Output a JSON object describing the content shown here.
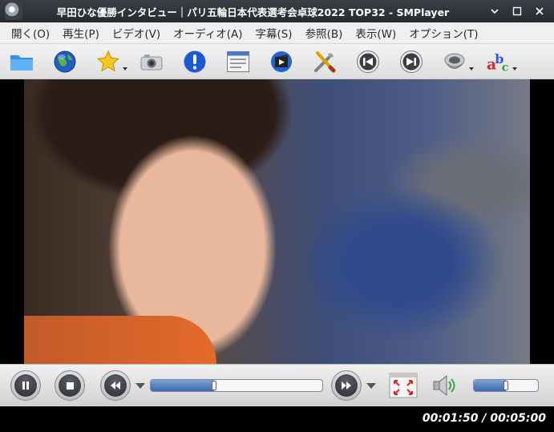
{
  "window": {
    "title": "早田ひな󠄀󠄀優勝インタビュー｜パリ五輪日本代表選考会󠄀󠄀卓球2022 TOP32 - SMPlayer",
    "minimize_glyph": "⌄",
    "maximize_glyph": "☐",
    "close_glyph": "✕"
  },
  "menubar": {
    "items": [
      {
        "label": "開く(O)"
      },
      {
        "label": "再生(P)"
      },
      {
        "label": "ビデオ(V)"
      },
      {
        "label": "オーディオ(A)"
      },
      {
        "label": "字幕(S)"
      },
      {
        "label": "参照(B)"
      },
      {
        "label": "表示(W)"
      },
      {
        "label": "オプション(T)"
      }
    ]
  },
  "toolbar": {
    "icons": [
      "folder-icon",
      "globe-icon",
      "favorites-star-icon",
      "screenshot-camera-icon",
      "info-icon",
      "playlist-icon",
      "video-clip-icon",
      "preferences-tools-icon",
      "previous-icon",
      "next-icon",
      "audio-track-icon",
      "subtitles-abc-icon"
    ]
  },
  "controls": {
    "seek_progress": 0.367,
    "volume_level": 0.5
  },
  "status": {
    "time": "00:01:50 / 00:05:00"
  }
}
